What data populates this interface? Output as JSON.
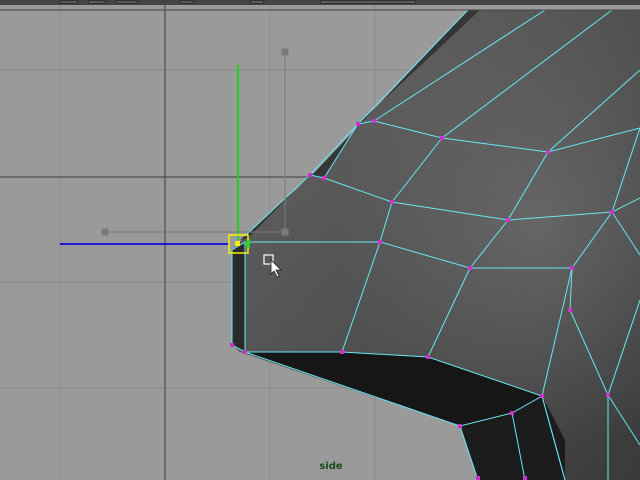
{
  "viewport": {
    "camera_label": "side",
    "background_color": "#9a9a9a",
    "grid_color": "#888888",
    "axis_color": "#3c3c3c",
    "wireframe_color": "#66e8f2",
    "vertex_color": "#cc33cc",
    "selection_color": "#f2f20d"
  },
  "manipulator": {
    "type": "move-tool",
    "y_axis_color": "#1ecf1e",
    "z_axis_color": "#1a1ad8",
    "x_axis_color": "#33cc33"
  },
  "toolbar": {
    "visible": "partial"
  }
}
